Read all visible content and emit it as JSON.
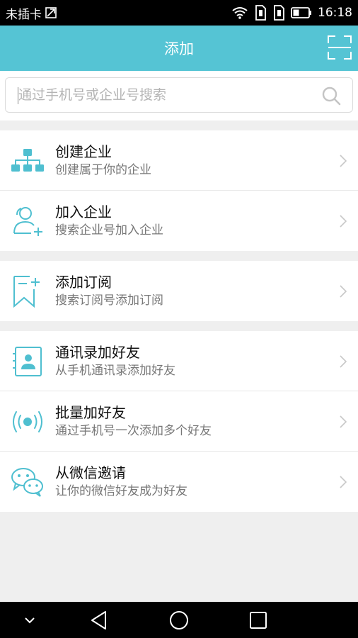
{
  "status_bar": {
    "carrier": "未插卡",
    "time": "16:18"
  },
  "header": {
    "title": "添加"
  },
  "search": {
    "placeholder": "通过手机号或企业号搜索"
  },
  "groups": [
    [
      {
        "title": "创建企业",
        "subtitle": "创建属于你的企业",
        "icon": "org-chart-icon"
      },
      {
        "title": "加入企业",
        "subtitle": "搜索企业号加入企业",
        "icon": "add-user-icon"
      }
    ],
    [
      {
        "title": "添加订阅",
        "subtitle": "搜索订阅号添加订阅",
        "icon": "bookmark-add-icon"
      }
    ],
    [
      {
        "title": "通讯录加好友",
        "subtitle": "从手机通讯录添加好友",
        "icon": "contacts-icon"
      },
      {
        "title": "批量加好友",
        "subtitle": "通过手机号一次添加多个好友",
        "icon": "broadcast-icon"
      },
      {
        "title": "从微信邀请",
        "subtitle": "让你的微信好友成为好友",
        "icon": "wechat-icon"
      }
    ]
  ],
  "colors": {
    "accent": "#55c4d4",
    "icon": "#4fbfd0"
  }
}
